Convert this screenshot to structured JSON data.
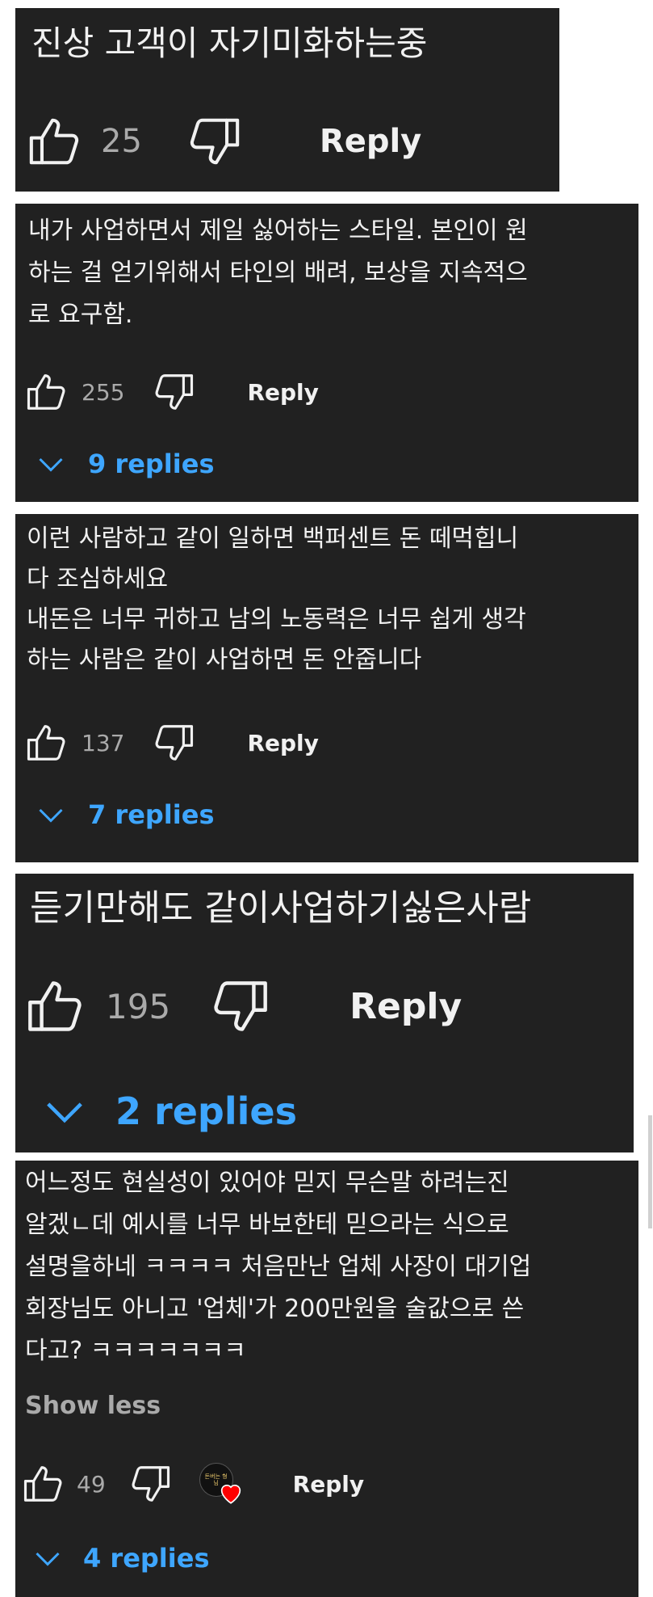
{
  "colors": {
    "card_bg": "#212121",
    "text": "#f1f1f1",
    "muted": "#aaaaaa",
    "link": "#3ea6ff",
    "heart": "#ff0000"
  },
  "comments": [
    {
      "text": "진상 고객이 자기미화하는중",
      "likes": "25",
      "reply_label": "Reply"
    },
    {
      "text": "내가 사업하면서 제일 싫어하는 스타일. 본인이 원\n하는 걸 얻기위해서 타인의 배려, 보상을 지속적으\n로 요구함.",
      "likes": "255",
      "reply_label": "Reply",
      "replies_label": "9 replies"
    },
    {
      "text": "이런 사람하고 같이 일하면 백퍼센트 돈 떼먹힙니\n다 조심하세요\n내돈은 너무 귀하고 남의 노동력은 너무 쉽게 생각\n하는 사람은 같이 사업하면 돈 안줍니다",
      "likes": "137",
      "reply_label": "Reply",
      "replies_label": "7 replies"
    },
    {
      "text": "듣기만해도 같이사업하기싫은사람",
      "likes": "195",
      "reply_label": "Reply",
      "replies_label": "2 replies"
    },
    {
      "text": "어느정도 현실성이 있어야 믿지 무슨말 하려는진\n알겠ㄴ데 예시를 너무 바보한테 믿으라는 식으로\n설명을하네 ㅋㅋㅋㅋ 처음만난 업체 사장이 대기업\n회장님도 아니고 '업체'가 200만원을 술값으로 쓴\n다고? ㅋㅋㅋㅋㅋㅋㅋ",
      "show_less_label": "Show less",
      "likes": "49",
      "creator_heart_avatar_text": "돈버는 형님",
      "reply_label": "Reply",
      "replies_label": "4 replies"
    }
  ]
}
